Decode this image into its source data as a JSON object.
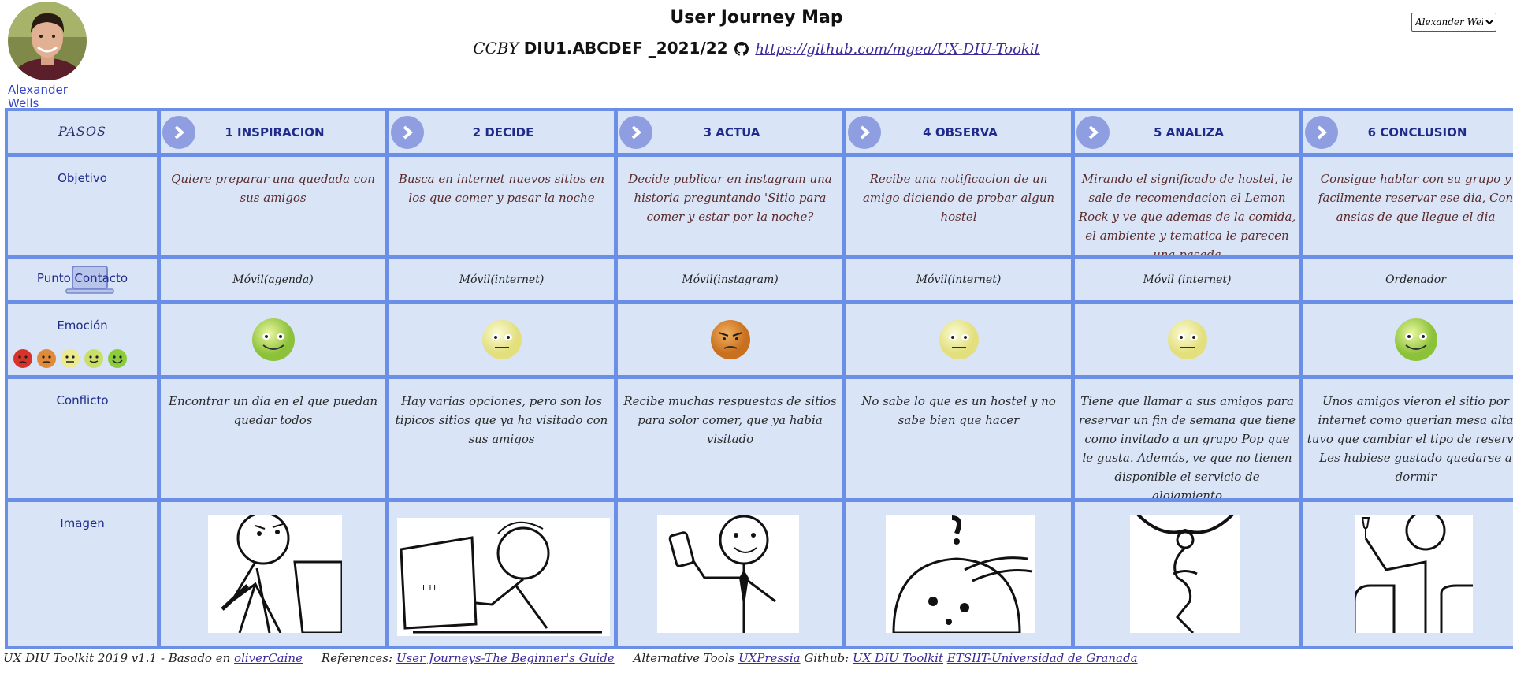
{
  "persona": {
    "name": "Alexander Wells",
    "photo": "persona-photo"
  },
  "header": {
    "title": "User Journey Map",
    "license": "CCBY",
    "course": "DIU1.ABCDEF _2021/22",
    "repo_link": "https://github.com/mgea/UX-DIU-Tookit"
  },
  "selector": {
    "selected": "Alexander Wells"
  },
  "rows": {
    "pasos": "PASOS",
    "objetivo": "Objetivo",
    "contacto": "Punto Contacto",
    "emocion": "Emoción",
    "conflicto": "Conflicto",
    "imagen": "Imagen"
  },
  "steps": [
    {
      "title": "1 INSPIRACION",
      "goal": "Quiere preparar una quedada con sus amigos",
      "contact": "Móvil(agenda)",
      "emotion": "happy",
      "conflict": "Encontrar un dia en el que puedan quedar todos",
      "image": "thinking-person"
    },
    {
      "title": "2 DECIDE",
      "goal": "Busca en internet nuevos sitios en los que comer y pasar la noche",
      "contact": "Móvil(internet)",
      "emotion": "neutral",
      "conflict": "Hay varias opciones, pero son los tipicos sitios que ya ha visitado con sus amigos",
      "image": "laptop-person"
    },
    {
      "title": "3 ACTUA",
      "goal": "Decide publicar en instagram una historia preguntando 'Sitio para comer y estar por la noche?",
      "contact": "Móvil(instagram)",
      "emotion": "annoyed",
      "conflict": "Recibe muchas respuestas de sitios para solor comer, que ya habia visitado",
      "image": "phone-person"
    },
    {
      "title": "4 OBSERVA",
      "goal": "Recibe una notificacion de un amigo diciendo de probar algun hostel",
      "contact": "Móvil(internet)",
      "emotion": "neutral",
      "conflict": "No sabe lo que es un hostel y no sabe bien que hacer",
      "image": "surprised-person"
    },
    {
      "title": "5 ANALIZA",
      "goal": "Mirando el significado de hostel, le sale de recomendacion el Lemon Rock y ve que ademas de la comida, el ambiente y tematica le parecen una pasada",
      "contact": "Móvil (internet)",
      "emotion": "neutral",
      "conflict": "Tiene que llamar a sus amigos para reservar un fin de semana que tiene como invitado a un grupo Pop que le gusta. Además, ve que no tienen disponible el servicio de alojamiento",
      "image": "pondering-person"
    },
    {
      "title": "6 CONCLUSION",
      "goal": "Consigue hablar con su grupo y facilmente reservar ese dia, Con ansias de que llegue el dia",
      "contact": "Ordenador",
      "emotion": "happy",
      "conflict": "Unos amigos vieron el sitio por internet como querian mesa alta tuvo que cambiar el tipo de reserva. Les hubiese gustado quedarse a dormir",
      "image": "toasting-person"
    }
  ],
  "footer": {
    "toolkit": "UX DIU Toolkit 2019 v1.1 - Basado en",
    "base_link": "oliverCaine",
    "references_label": "References:",
    "references_link": "User Journeys-The Beginner's Guide",
    "alt_label": "Alternative Tools",
    "alt_link": "UXPressia",
    "github_label": "Github:",
    "github_link": "UX DIU Toolkit",
    "etsiit_link": "ETSIIT-Universidad de Granada"
  },
  "colors": {
    "grid_border": "#6b8fe6",
    "cell_bg": "#d9e4f7",
    "header_text": "#1f2b8a",
    "chevron": "#8e9ee0"
  }
}
